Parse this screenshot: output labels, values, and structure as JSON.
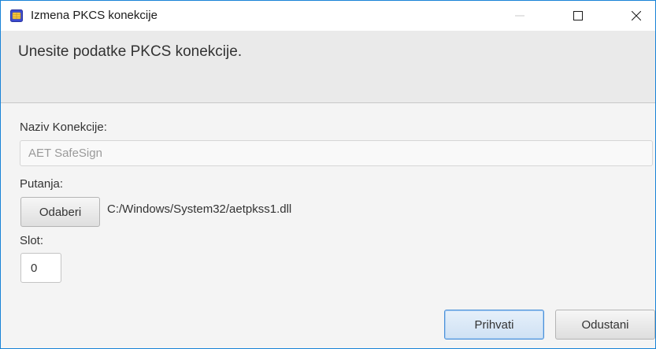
{
  "window": {
    "title": "Izmena PKCS konekcije",
    "app_icon": "smartcard-chip-icon"
  },
  "header": {
    "text": "Unesite podatke PKCS konekcije."
  },
  "form": {
    "name_label": "Naziv Konekcije:",
    "name_value": "AET SafeSign",
    "path_label": "Putanja:",
    "browse_label": "Odaberi",
    "path_value": "C:/Windows/System32/aetpkss1.dll",
    "slot_label": "Slot:",
    "slot_value": "0"
  },
  "buttons": {
    "accept_label": "Prihvati",
    "cancel_label": "Odustani"
  },
  "colors": {
    "window_border": "#1883d7",
    "accept_border": "#4a90d9"
  }
}
